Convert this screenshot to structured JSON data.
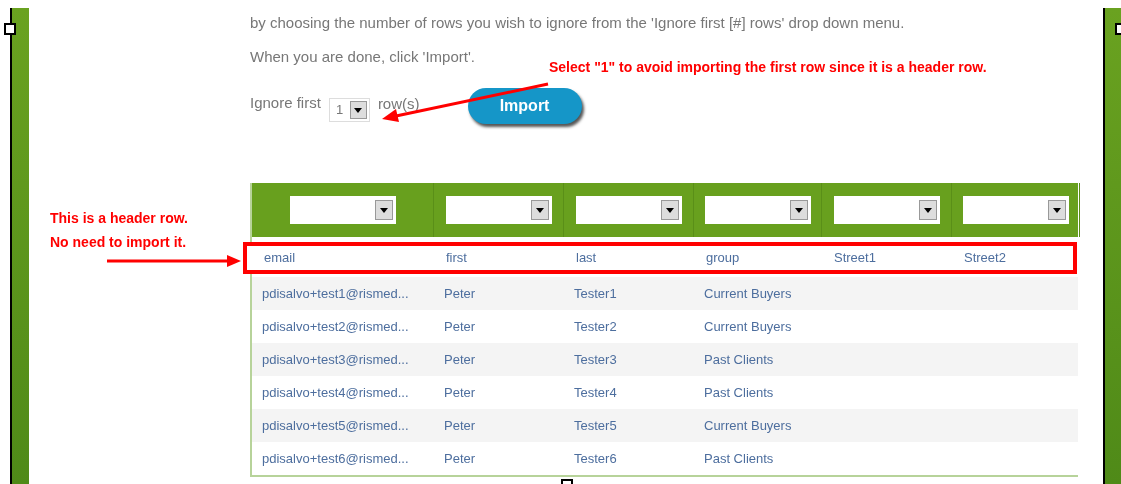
{
  "instructions": [
    "by choosing the number of rows you wish to ignore from the 'Ignore first [#] rows' drop down menu.",
    "When you are done, click 'Import'."
  ],
  "ignore_rows": {
    "label": "Ignore first",
    "value": "1",
    "suffix": "row(s)"
  },
  "import_button": "Import",
  "table": {
    "column_selectors": [
      {
        "kind": "dropdown"
      },
      {
        "kind": "dropdown"
      },
      {
        "kind": "dropdown"
      },
      {
        "kind": "dropdown"
      },
      {
        "kind": "dropdown"
      },
      {
        "kind": "dropdown"
      }
    ],
    "rows": [
      {
        "outlined": true,
        "cells": [
          "email",
          "first",
          "last",
          "group",
          "Street1",
          "Street2"
        ]
      },
      {
        "outlined": false,
        "cells": [
          "pdisalvo+test1@rismed...",
          "Peter",
          "Tester1",
          "Current Buyers"
        ]
      },
      {
        "outlined": false,
        "cells": [
          "pdisalvo+test2@rismed...",
          "Peter",
          "Tester2",
          "Current Buyers"
        ]
      },
      {
        "outlined": false,
        "cells": [
          "pdisalvo+test3@rismed...",
          "Peter",
          "Tester3",
          "Past Clients"
        ]
      },
      {
        "outlined": false,
        "cells": [
          "pdisalvo+test4@rismed...",
          "Peter",
          "Tester4",
          "Past Clients"
        ]
      },
      {
        "outlined": false,
        "cells": [
          "pdisalvo+test5@rismed...",
          "Peter",
          "Tester5",
          "Current Buyers"
        ]
      },
      {
        "outlined": false,
        "cells": [
          "pdisalvo+test6@rismed...",
          "Peter",
          "Tester6",
          "Past Clients"
        ]
      }
    ]
  },
  "annotations": [
    {
      "kind": "top",
      "text": "Select \"1\" to avoid importing the first row since it is a header row."
    },
    {
      "kind": "side",
      "lines": [
        "This is a header row.",
        "No need to import it."
      ]
    }
  ]
}
